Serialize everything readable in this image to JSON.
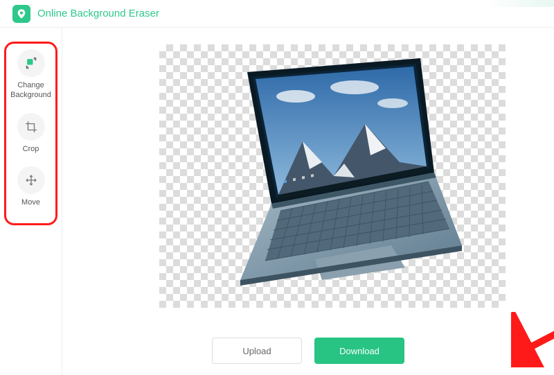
{
  "header": {
    "app_title": "Online Background Eraser"
  },
  "sidebar": {
    "tools": [
      {
        "label": "Change\nBackground",
        "icon": "change-background-icon"
      },
      {
        "label": "Crop",
        "icon": "crop-icon"
      },
      {
        "label": "Move",
        "icon": "move-icon"
      }
    ]
  },
  "canvas": {
    "subject_description": "laptop with mountain wallpaper on transparent background"
  },
  "actions": {
    "upload_label": "Upload",
    "download_label": "Download"
  },
  "colors": {
    "accent": "#27c484",
    "highlight": "#ff1a1a"
  }
}
